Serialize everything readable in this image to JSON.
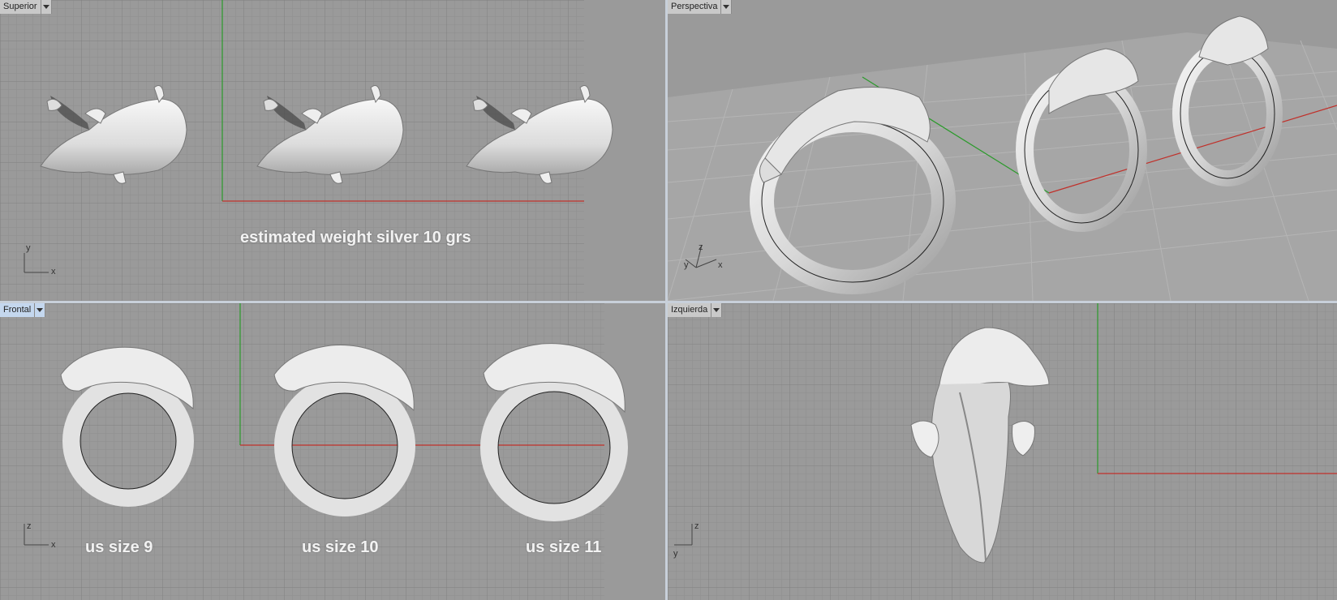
{
  "viewports": {
    "top": {
      "label": "Superior"
    },
    "perspective": {
      "label": "Perspectiva"
    },
    "front": {
      "label": "Frontal"
    },
    "left": {
      "label": "Izquierda"
    }
  },
  "annotations": {
    "weight": "estimated weight silver 10 grs",
    "sizes": [
      "us size 9",
      "us size 10",
      "us size 11"
    ]
  },
  "axes": {
    "top": [
      "y",
      "x"
    ],
    "perspective": [
      "z",
      "y",
      "x"
    ],
    "front": [
      "z",
      "x"
    ],
    "left": [
      "z",
      "y"
    ]
  },
  "colors": {
    "viewport_bg": "#9a9a9a",
    "grid_minor": "#8d8d8d",
    "grid_major": "#7e7e7e",
    "axis_x": "#c0302a",
    "axis_y": "#2b9a2b",
    "model": "#eeeeee",
    "active_label": "#c4d7ee"
  }
}
